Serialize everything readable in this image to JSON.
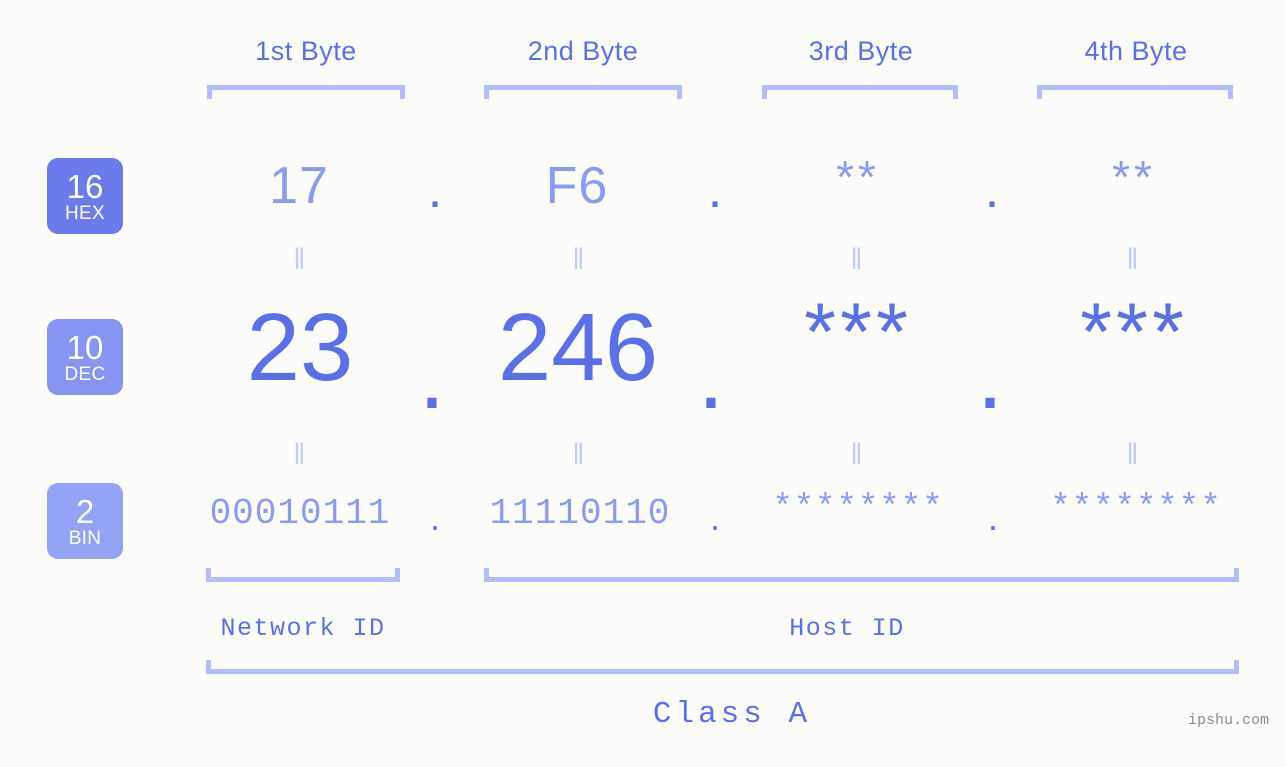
{
  "meta": {
    "background_color": "#fcfdfa",
    "accent_dark": "#5b6fe8",
    "accent_mid": "#8b9bf4",
    "accent_light": "#b3bdfb",
    "watermark": "ipshu.com"
  },
  "byte_headers": [
    {
      "label": "1st Byte"
    },
    {
      "label": "2nd Byte"
    },
    {
      "label": "3rd Byte"
    },
    {
      "label": "4th Byte"
    }
  ],
  "bases": [
    {
      "number": "16",
      "name": "HEX",
      "color": "#6b7bec"
    },
    {
      "number": "10",
      "name": "DEC",
      "color": "#8695f3"
    },
    {
      "number": "2",
      "name": "BIN",
      "color": "#93a4f7"
    }
  ],
  "rows": {
    "hex": {
      "base_number": "16",
      "base_name": "HEX",
      "values": [
        "17",
        "F6",
        "**",
        "**"
      ],
      "separators": [
        ".",
        ".",
        "."
      ]
    },
    "dec": {
      "base_number": "10",
      "base_name": "DEC",
      "values": [
        "23",
        "246",
        "***",
        "***"
      ],
      "separators": [
        ".",
        ".",
        "."
      ]
    },
    "bin": {
      "base_number": "2",
      "base_name": "BIN",
      "values": [
        "00010111",
        "11110110",
        "********",
        "********"
      ],
      "separators": [
        ".",
        ".",
        "."
      ]
    }
  },
  "equals_markers": [
    "‖",
    "‖",
    "‖",
    "‖",
    "‖",
    "‖",
    "‖",
    "‖"
  ],
  "sections": [
    {
      "label": "Network ID"
    },
    {
      "label": "Host ID"
    }
  ],
  "class": {
    "label": "Class A"
  }
}
